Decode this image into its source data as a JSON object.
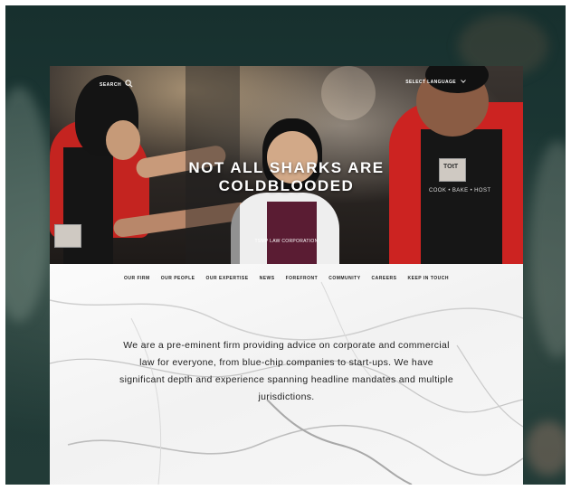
{
  "header": {
    "search_label": "SEARCH",
    "language_label": "SELECT LANGUAGE",
    "search_icon": "search-icon",
    "language_icon": "chevron-down-icon"
  },
  "hero": {
    "headline_line1": "NOT ALL SHARKS ARE",
    "headline_line2": "COLDBLOODED",
    "subhead": "TSMP LAW CORPORATION",
    "apron_text": "COOK • BAKE • HOST",
    "badge_text": "TOtT"
  },
  "nav": {
    "items": [
      "OUR FIRM",
      "OUR PEOPLE",
      "OUR EXPERTISE",
      "NEWS",
      "FOREFRONT",
      "COMMUNITY",
      "CAREERS",
      "KEEP IN TOUCH"
    ]
  },
  "intro": {
    "text": "We are a pre-eminent firm providing advice on corporate and commercial law for everyone, from blue-chip companies to start-ups. We have significant depth and experience spanning headline mandates and multiple jurisdictions."
  },
  "colors": {
    "backdrop": "#1d3835",
    "shirt_red": "#d3201c",
    "apron_black": "#1a1a1a",
    "text_dark": "#222222"
  }
}
